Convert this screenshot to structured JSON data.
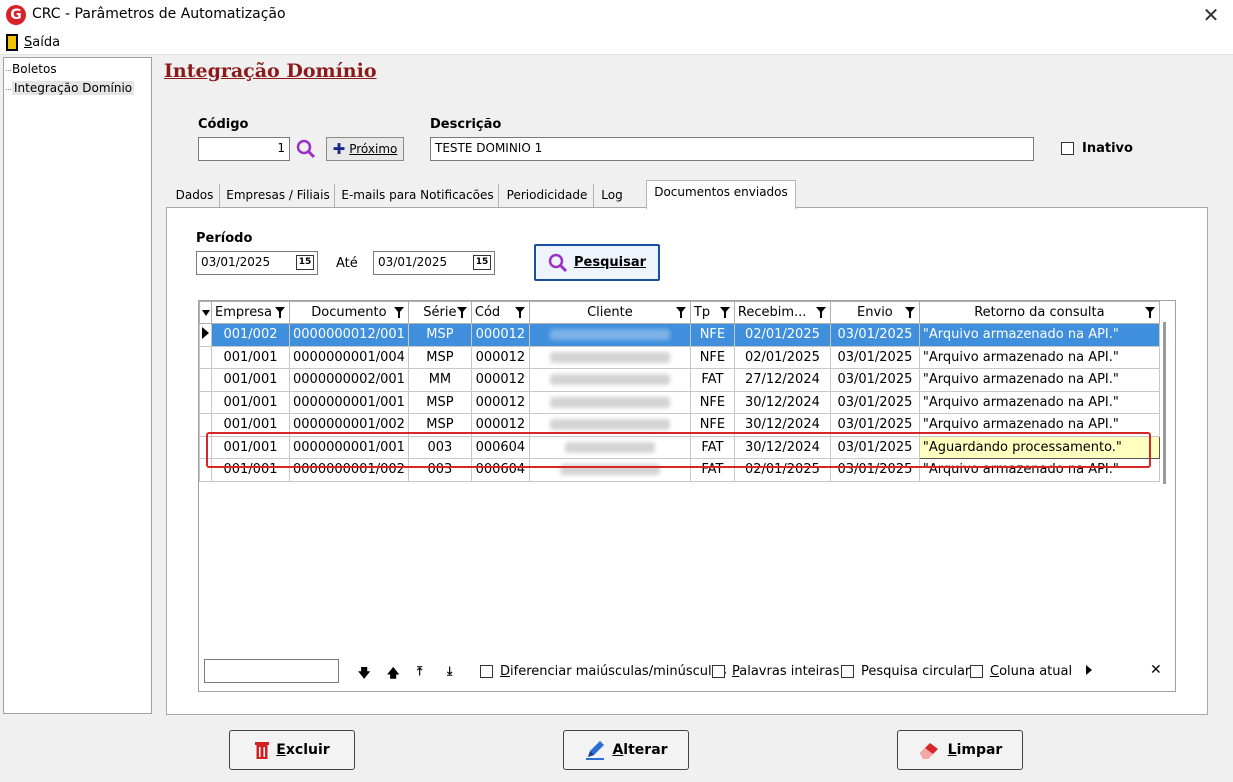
{
  "window": {
    "title": "CRC - Parâmetros de Automatização",
    "logo_letter": "G",
    "close_glyph": "✕"
  },
  "menu": {
    "exit_label_first": "S",
    "exit_label_rest": "aída"
  },
  "tree": {
    "items": [
      {
        "label": "Boletos"
      },
      {
        "label": "Integração Domínio"
      }
    ]
  },
  "page": {
    "title": "Integração Domínio"
  },
  "form": {
    "codigo_label": "Código",
    "codigo_value": "1",
    "proximo_label": "Próximo",
    "descricao_label": "Descrição",
    "descricao_value": "TESTE DOMINIO 1",
    "inativo_label": "Inativo"
  },
  "tabs": [
    {
      "label": "Dados"
    },
    {
      "label": "Empresas / Filiais"
    },
    {
      "label": "E-mails para Notificacões"
    },
    {
      "label": "Periodicidade"
    },
    {
      "label": "Log"
    },
    {
      "label": "Documentos enviados"
    }
  ],
  "filter": {
    "periodo_label": "Período",
    "date_from": "03/01/2025",
    "ate_label": "Até",
    "date_to": "03/01/2025",
    "calendar_glyph": "15",
    "search_button": "Pesquisar"
  },
  "grid": {
    "columns": [
      "Empresa",
      "Documento",
      "Série",
      "Cód",
      "Cliente",
      "Tp",
      "Recebim...",
      "Envio",
      "Retorno da consulta"
    ],
    "rows": [
      {
        "empresa": "001/002",
        "documento": "0000000012/001",
        "serie": "MSP",
        "cod": "000012",
        "tp": "NFE",
        "recebimento": "02/01/2025",
        "envio": "03/01/2025",
        "retorno": "\"Arquivo armazenado na API.\""
      },
      {
        "empresa": "001/001",
        "documento": "0000000001/004",
        "serie": "MSP",
        "cod": "000012",
        "tp": "NFE",
        "recebimento": "02/01/2025",
        "envio": "03/01/2025",
        "retorno": "\"Arquivo armazenado na API.\""
      },
      {
        "empresa": "001/001",
        "documento": "0000000002/001",
        "serie": "MM",
        "cod": "000012",
        "tp": "FAT",
        "recebimento": "27/12/2024",
        "envio": "03/01/2025",
        "retorno": "\"Arquivo armazenado na API.\""
      },
      {
        "empresa": "001/001",
        "documento": "0000000001/001",
        "serie": "MSP",
        "cod": "000012",
        "tp": "NFE",
        "recebimento": "30/12/2024",
        "envio": "03/01/2025",
        "retorno": "\"Arquivo armazenado na API.\""
      },
      {
        "empresa": "001/001",
        "documento": "0000000001/002",
        "serie": "MSP",
        "cod": "000012",
        "tp": "NFE",
        "recebimento": "30/12/2024",
        "envio": "03/01/2025",
        "retorno": "\"Arquivo armazenado na API.\""
      },
      {
        "empresa": "001/001",
        "documento": "0000000001/001",
        "serie": "003",
        "cod": "000604",
        "tp": "FAT",
        "recebimento": "30/12/2024",
        "envio": "03/01/2025",
        "retorno": "\"Aguardando processamento.\""
      },
      {
        "empresa": "001/001",
        "documento": "0000000001/002",
        "serie": "003",
        "cod": "000604",
        "tp": "FAT",
        "recebimento": "02/01/2025",
        "envio": "03/01/2025",
        "retorno": "\"Arquivo armazenado na API.\""
      }
    ]
  },
  "searchbar": {
    "opt1_u": "D",
    "opt1_rest": "iferenciar maiúsculas/minúsculas",
    "opt2_u": "P",
    "opt2_rest": "alavras inteiras",
    "opt3": "Pesquisa circular",
    "opt4_u": "C",
    "opt4_rest": "oluna atual",
    "close_glyph": "✕"
  },
  "buttons": {
    "excluir_u": "E",
    "excluir_rest": "xcluir",
    "alterar_u": "A",
    "alterar_rest": "lterar",
    "limpar_u": "L",
    "limpar_rest": "impar"
  },
  "colors": {
    "accent": "#8b1a1a",
    "selection": "#3f8fdc",
    "highlight_box": "#d42727"
  }
}
